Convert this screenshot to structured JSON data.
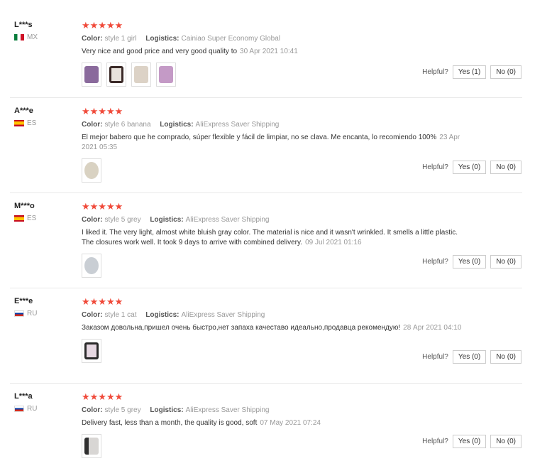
{
  "helpful_label": "Helpful?",
  "reviews": [
    {
      "user": "L***s",
      "country": "MX",
      "stars": "★★★★★",
      "color_label": "Color:",
      "color": "style 1 girl",
      "logistics_label": "Logistics:",
      "logistics": "Cainiao Super Economy Global",
      "text": "Very nice and good price and very good quality to",
      "date": "30 Apr 2021 10:41",
      "yes": "Yes (1)",
      "no": "No (0)"
    },
    {
      "user": "A***e",
      "country": "ES",
      "stars": "★★★★★",
      "color_label": "Color:",
      "color": "style 6 banana",
      "logistics_label": "Logistics:",
      "logistics": "AliExpress Saver Shipping",
      "text": "El mejor babero que he comprado, súper flexible y fácil de limpiar, no se clava. Me encanta, lo recomiendo 100%",
      "date": "23 Apr 2021 05:35",
      "yes": "Yes (0)",
      "no": "No (0)"
    },
    {
      "user": "M***o",
      "country": "ES",
      "stars": "★★★★★",
      "color_label": "Color:",
      "color": "style 5 grey",
      "logistics_label": "Logistics:",
      "logistics": "AliExpress Saver Shipping",
      "text": "I liked it. The very light, almost white bluish gray color. The material is nice and it wasn't wrinkled. It smells a little plastic. The closures work well. It took 9 days to arrive with combined delivery.",
      "date": "09 Jul 2021 01:16",
      "yes": "Yes (0)",
      "no": "No (0)"
    },
    {
      "user": "E***e",
      "country": "RU",
      "stars": "★★★★★",
      "color_label": "Color:",
      "color": "style 1 cat",
      "logistics_label": "Logistics:",
      "logistics": "AliExpress Saver Shipping",
      "text": "Заказом довольна,пришел очень быстро,нет запаха качеставо идеально,продавца рекомендую!",
      "date": "28 Apr 2021 04:10",
      "yes": "Yes (0)",
      "no": "No (0)"
    },
    {
      "user": "L***a",
      "country": "RU",
      "stars": "★★★★★",
      "color_label": "Color:",
      "color": "style 5 grey",
      "logistics_label": "Logistics:",
      "logistics": "AliExpress Saver Shipping",
      "text": "Delivery fast, less than a month, the quality is good, soft",
      "date": "07 May 2021 07:24",
      "yes": "Yes (0)",
      "no": "No (0)"
    }
  ]
}
